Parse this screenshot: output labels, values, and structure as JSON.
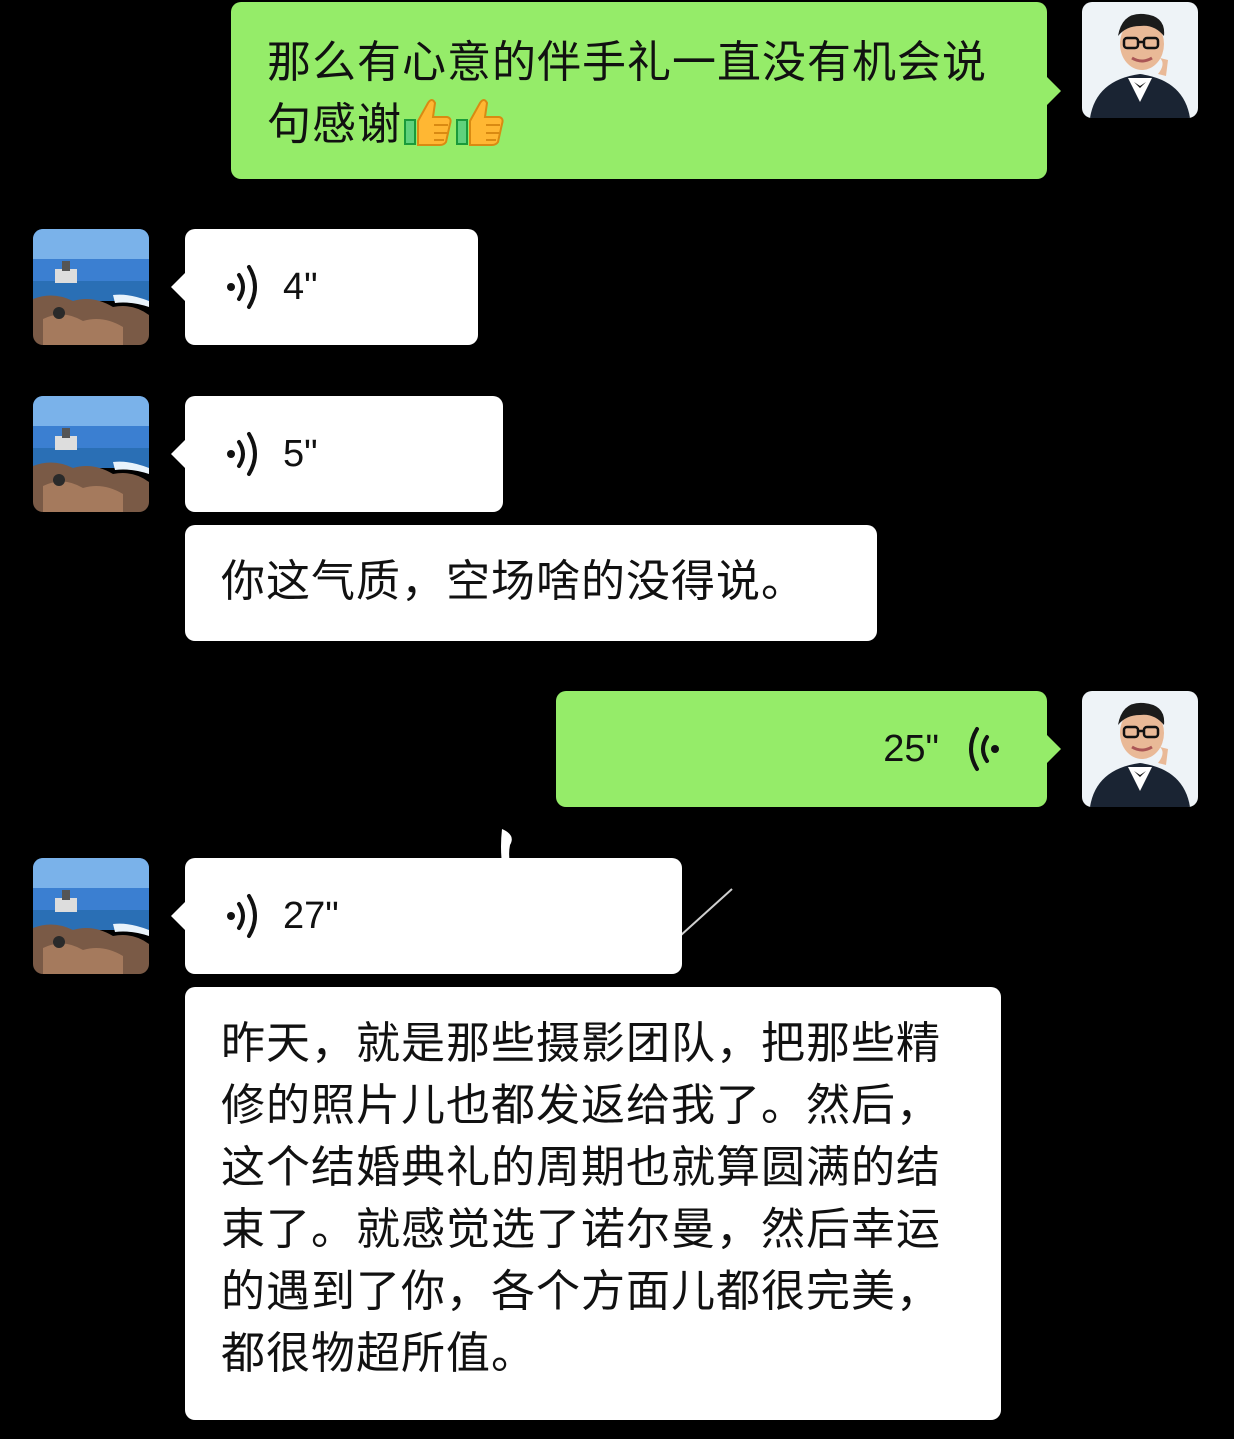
{
  "messages": [
    {
      "side": "right",
      "type": "text",
      "text": "那么有心意的伴手礼一直没有机会说句感谢",
      "emoji": [
        "thumbs-up",
        "thumbs-up"
      ]
    },
    {
      "side": "left",
      "type": "voice",
      "duration": "4\""
    },
    {
      "side": "left",
      "type": "voice",
      "duration": "5\""
    },
    {
      "side": "left",
      "type": "text",
      "text": "你这气质，空场啥的没得说。"
    },
    {
      "side": "right",
      "type": "voice",
      "duration": "25\""
    },
    {
      "side": "left",
      "type": "voice",
      "duration": "27\""
    },
    {
      "side": "left",
      "type": "text",
      "text": "昨天，就是那些摄影团队，把那些精修的照片儿也都发返给我了。然后，这个结婚典礼的周期也就算圆满的结束了。就感觉选了诺尔曼，然后幸运的遇到了你，各个方面儿都很完美，都很物超所值。"
    }
  ],
  "colors": {
    "background": "#000000",
    "sent_bubble": "#95ec69",
    "received_bubble": "#ffffff",
    "text": "#111111"
  },
  "icons": {
    "received_voice": "voice-wave-right-icon",
    "sent_voice": "voice-wave-left-icon",
    "emoji": "thumbs-up-icon"
  }
}
